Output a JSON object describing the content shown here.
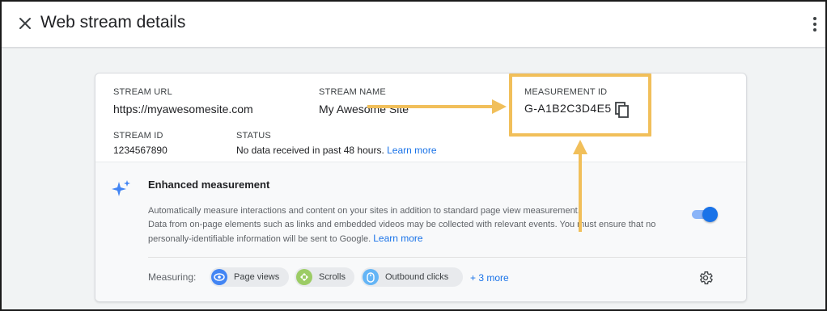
{
  "header": {
    "title": "Web stream details",
    "close_icon": "close-icon",
    "more_icon": "more-vert-icon"
  },
  "stream": {
    "url_label": "STREAM URL",
    "url_value": "https://myawesomesite.com",
    "name_label": "STREAM NAME",
    "name_value": "My Awesome Site",
    "measurement_label": "MEASUREMENT ID",
    "measurement_value": "G-A1B2C3D4E5",
    "id_label": "STREAM ID",
    "id_value": "1234567890",
    "status_label": "STATUS",
    "status_value": "No data received in past 48 hours.",
    "status_link": "Learn more"
  },
  "enhanced": {
    "title": "Enhanced measurement",
    "desc_line1": "Automatically measure interactions and content on your sites in addition to standard page view measurement.",
    "desc_line2": "Data from on-page elements such as links and embedded videos may be collected with relevant events. You must ensure that no",
    "desc_line3": "personally-identifiable information will be sent to Google.",
    "desc_link": "Learn more",
    "toggle_on": true,
    "measuring_label": "Measuring:",
    "chips": [
      {
        "label": "Page views",
        "icon": "eye-icon",
        "color": "#4285f4"
      },
      {
        "label": "Scrolls",
        "icon": "scroll-icon",
        "color": "#9ccc65"
      },
      {
        "label": "Outbound clicks",
        "icon": "mouse-icon",
        "color": "#64b5f6"
      }
    ],
    "more_label": "+ 3 more"
  },
  "colors": {
    "accent": "#1a73e8",
    "highlight": "#f1bf5a",
    "background": "#f1f3f4"
  }
}
